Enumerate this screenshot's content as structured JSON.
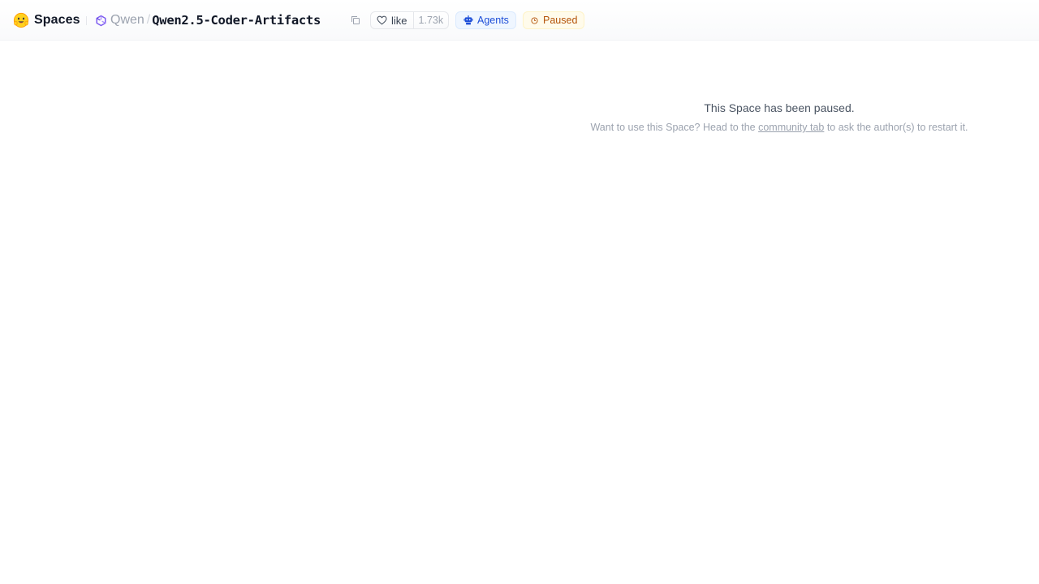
{
  "header": {
    "brand_label": "Spaces",
    "org_name": "Qwen",
    "separator": "/",
    "repo_name": "Qwen2.5-Coder-Artifacts",
    "like_label": "like",
    "like_count": "1.73k",
    "agents_badge": "Agents",
    "status_badge": "Paused",
    "icons": {
      "brand": "hugging-face-icon",
      "org": "qwen-logo-icon",
      "copy": "copy-icon",
      "like": "heart-icon",
      "agents": "robot-icon",
      "status": "clock-icon"
    },
    "colors": {
      "agents": "#1d4ed8",
      "paused": "#b45309"
    }
  },
  "main": {
    "notice_title": "This Space has been paused.",
    "notice_prefix": "Want to use this Space? Head to the ",
    "community_link": "community tab",
    "notice_suffix": " to ask the author(s) to restart it."
  }
}
